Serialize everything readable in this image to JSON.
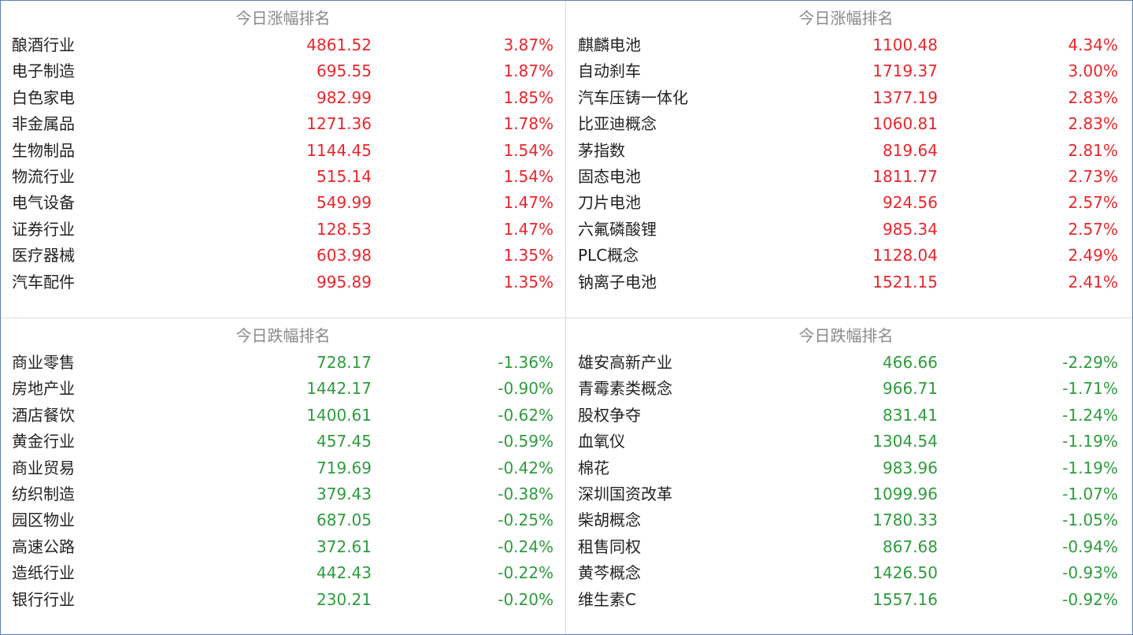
{
  "colors": {
    "up": "#e8262c",
    "down": "#2e9c3c",
    "title": "#8a8a8a",
    "border": "#5b7fb6"
  },
  "panels": {
    "industry_gainers": {
      "title": "今日涨幅排名",
      "rows": [
        {
          "name": "酿酒行业",
          "value": "4861.52",
          "change": "3.87%"
        },
        {
          "name": "电子制造",
          "value": "695.55",
          "change": "1.87%"
        },
        {
          "name": "白色家电",
          "value": "982.99",
          "change": "1.85%"
        },
        {
          "name": "非金属品",
          "value": "1271.36",
          "change": "1.78%"
        },
        {
          "name": "生物制品",
          "value": "1144.45",
          "change": "1.54%"
        },
        {
          "name": "物流行业",
          "value": "515.14",
          "change": "1.54%"
        },
        {
          "name": "电气设备",
          "value": "549.99",
          "change": "1.47%"
        },
        {
          "name": "证券行业",
          "value": "128.53",
          "change": "1.47%"
        },
        {
          "name": "医疗器械",
          "value": "603.98",
          "change": "1.35%"
        },
        {
          "name": "汽车配件",
          "value": "995.89",
          "change": "1.35%"
        }
      ]
    },
    "concept_gainers": {
      "title": "今日涨幅排名",
      "rows": [
        {
          "name": "麒麟电池",
          "value": "1100.48",
          "change": "4.34%"
        },
        {
          "name": "自动刹车",
          "value": "1719.37",
          "change": "3.00%"
        },
        {
          "name": "汽车压铸一体化",
          "value": "1377.19",
          "change": "2.83%"
        },
        {
          "name": "比亚迪概念",
          "value": "1060.81",
          "change": "2.83%"
        },
        {
          "name": "茅指数",
          "value": "819.64",
          "change": "2.81%"
        },
        {
          "name": "固态电池",
          "value": "1811.77",
          "change": "2.73%"
        },
        {
          "name": "刀片电池",
          "value": "924.56",
          "change": "2.57%"
        },
        {
          "name": "六氟磷酸锂",
          "value": "985.34",
          "change": "2.57%"
        },
        {
          "name": "PLC概念",
          "value": "1128.04",
          "change": "2.49%"
        },
        {
          "name": "钠离子电池",
          "value": "1521.15",
          "change": "2.41%"
        }
      ]
    },
    "industry_losers": {
      "title": "今日跌幅排名",
      "rows": [
        {
          "name": "商业零售",
          "value": "728.17",
          "change": "-1.36%"
        },
        {
          "name": "房地产业",
          "value": "1442.17",
          "change": "-0.90%"
        },
        {
          "name": "酒店餐饮",
          "value": "1400.61",
          "change": "-0.62%"
        },
        {
          "name": "黄金行业",
          "value": "457.45",
          "change": "-0.59%"
        },
        {
          "name": "商业贸易",
          "value": "719.69",
          "change": "-0.42%"
        },
        {
          "name": "纺织制造",
          "value": "379.43",
          "change": "-0.38%"
        },
        {
          "name": "园区物业",
          "value": "687.05",
          "change": "-0.25%"
        },
        {
          "name": "高速公路",
          "value": "372.61",
          "change": "-0.24%"
        },
        {
          "name": "造纸行业",
          "value": "442.43",
          "change": "-0.22%"
        },
        {
          "name": "银行行业",
          "value": "230.21",
          "change": "-0.20%"
        }
      ]
    },
    "concept_losers": {
      "title": "今日跌幅排名",
      "rows": [
        {
          "name": "雄安高新产业",
          "value": "466.66",
          "change": "-2.29%"
        },
        {
          "name": "青霉素类概念",
          "value": "966.71",
          "change": "-1.71%"
        },
        {
          "name": "股权争夺",
          "value": "831.41",
          "change": "-1.24%"
        },
        {
          "name": "血氧仪",
          "value": "1304.54",
          "change": "-1.19%"
        },
        {
          "name": "棉花",
          "value": "983.96",
          "change": "-1.19%"
        },
        {
          "name": "深圳国资改革",
          "value": "1099.96",
          "change": "-1.07%"
        },
        {
          "name": "柴胡概念",
          "value": "1780.33",
          "change": "-1.05%"
        },
        {
          "name": "租售同权",
          "value": "867.68",
          "change": "-0.94%"
        },
        {
          "name": "黄芩概念",
          "value": "1426.50",
          "change": "-0.93%"
        },
        {
          "name": "维生素C",
          "value": "1557.16",
          "change": "-0.92%"
        }
      ]
    }
  }
}
